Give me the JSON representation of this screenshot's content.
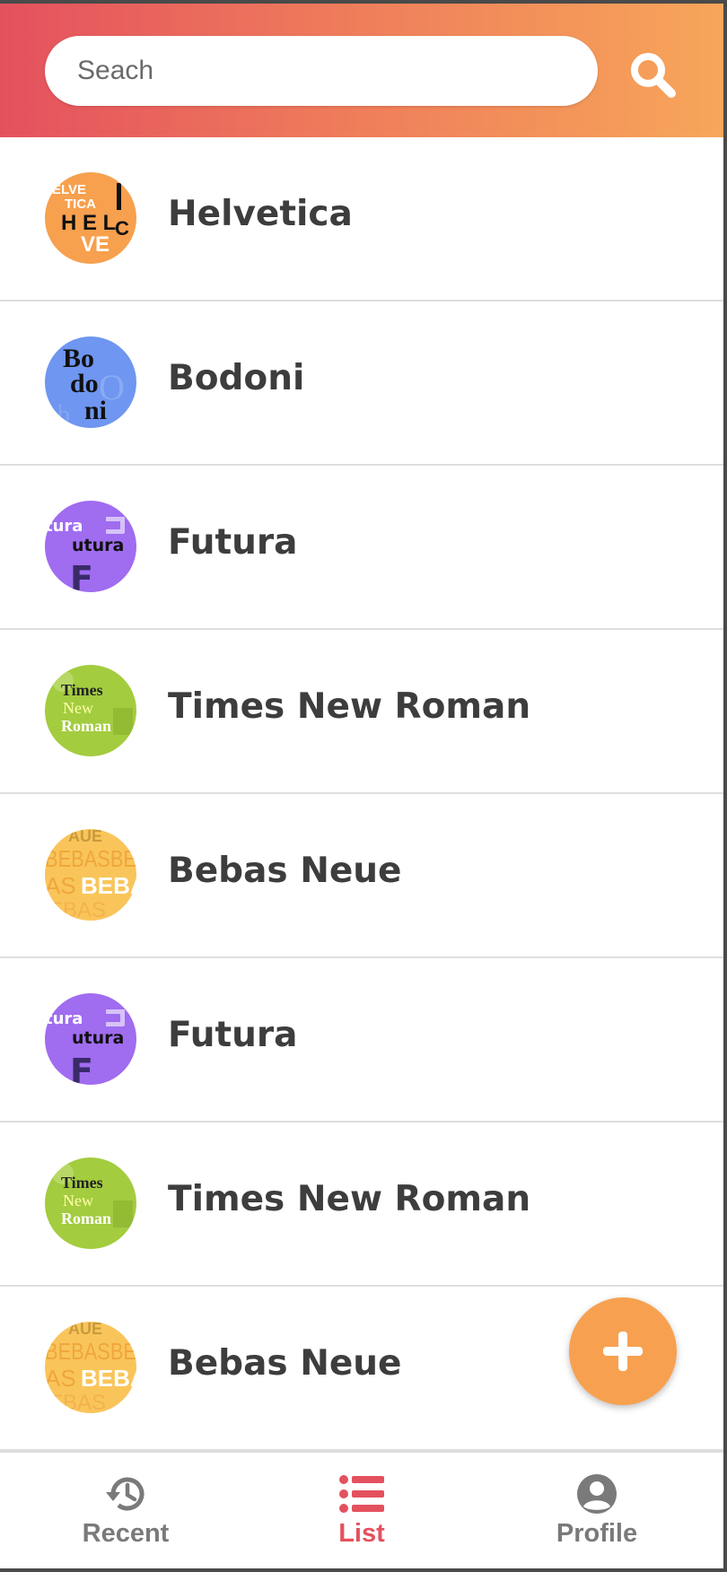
{
  "search": {
    "placeholder": "Seach",
    "value": ""
  },
  "fonts": [
    {
      "label": "Helvetica",
      "thumb": "helvetica-thumbnail"
    },
    {
      "label": "Bodoni",
      "thumb": "bodoni-thumbnail"
    },
    {
      "label": "Futura",
      "thumb": "futura-thumbnail"
    },
    {
      "label": "Times New Roman",
      "thumb": "times-new-roman-thumbnail"
    },
    {
      "label": "Bebas Neue",
      "thumb": "bebas-neue-thumbnail"
    },
    {
      "label": "Futura",
      "thumb": "futura-thumbnail"
    },
    {
      "label": "Times New Roman",
      "thumb": "times-new-roman-thumbnail"
    },
    {
      "label": "Bebas Neue",
      "thumb": "bebas-neue-thumbnail"
    }
  ],
  "fab": {
    "icon": "plus-icon"
  },
  "nav": {
    "recent": {
      "label": "Recent",
      "icon": "history-icon"
    },
    "list": {
      "label": "List",
      "icon": "list-icon",
      "active": true
    },
    "profile": {
      "label": "Profile",
      "icon": "account-circle-icon"
    }
  },
  "colors": {
    "header_start": "#e4515e",
    "header_end": "#f7a65a",
    "accent": "#e4515e",
    "fab": "#f7a150",
    "text": "#3d3d3d",
    "nav_inactive": "#7a7a7a"
  }
}
